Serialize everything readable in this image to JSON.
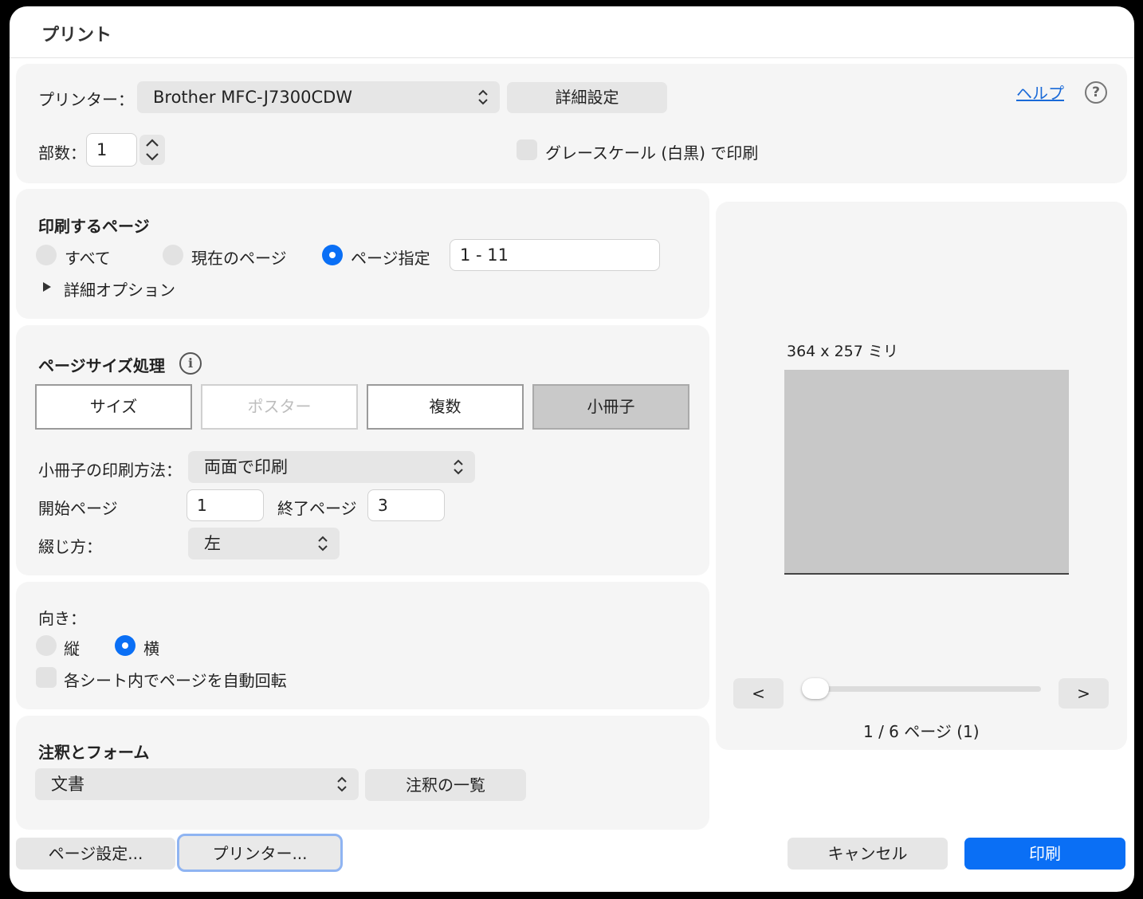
{
  "window": {
    "title": "プリント"
  },
  "printer": {
    "label": "プリンター：",
    "selected": "Brother MFC-J7300CDW",
    "details_button": "詳細設定",
    "help_link": "ヘルプ",
    "help_icon": "?"
  },
  "copies": {
    "label": "部数：",
    "value": "1"
  },
  "grayscale": {
    "label": "グレースケール (白黒) で印刷",
    "checked": false
  },
  "pages": {
    "heading": "印刷するページ",
    "options": [
      {
        "label": "すべて",
        "selected": false
      },
      {
        "label": "現在のページ",
        "selected": false
      },
      {
        "label": "ページ指定",
        "selected": true
      }
    ],
    "range_value": "1 - 11",
    "advanced_label": "詳細オプション"
  },
  "page_size": {
    "heading": "ページサイズ処理",
    "info_icon": "i",
    "tabs": [
      {
        "label": "サイズ",
        "state": "normal"
      },
      {
        "label": "ポスター",
        "state": "disabled"
      },
      {
        "label": "複数",
        "state": "normal"
      },
      {
        "label": "小冊子",
        "state": "active"
      }
    ],
    "booklet_method_label": "小冊子の印刷方法：",
    "booklet_method_value": "両面で印刷",
    "start_page_label": "開始ページ",
    "start_page_value": "1",
    "end_page_label": "終了ページ",
    "end_page_value": "3",
    "binding_label": "綴じ方：",
    "binding_value": "左"
  },
  "orientation": {
    "heading": "向き：",
    "options": [
      {
        "label": "縦",
        "selected": false
      },
      {
        "label": "横",
        "selected": true
      }
    ],
    "auto_rotate_label": "各シート内でページを自動回転",
    "auto_rotate_checked": false
  },
  "annotations": {
    "heading": "注釈とフォーム",
    "selected": "文書",
    "list_button": "注釈の一覧"
  },
  "preview": {
    "dimensions": "364 x 257 ミリ",
    "prev_label": "<",
    "next_label": ">",
    "page_status": "1 / 6 ページ (1)",
    "slider_fraction": 0
  },
  "footer": {
    "page_setup_button": "ページ設定...",
    "printer_button": "プリンター...",
    "cancel_button": "キャンセル",
    "print_button": "印刷"
  },
  "colors": {
    "accent": "#0a6ff5",
    "panel": "#f5f5f5",
    "control": "#e6e6e6"
  }
}
